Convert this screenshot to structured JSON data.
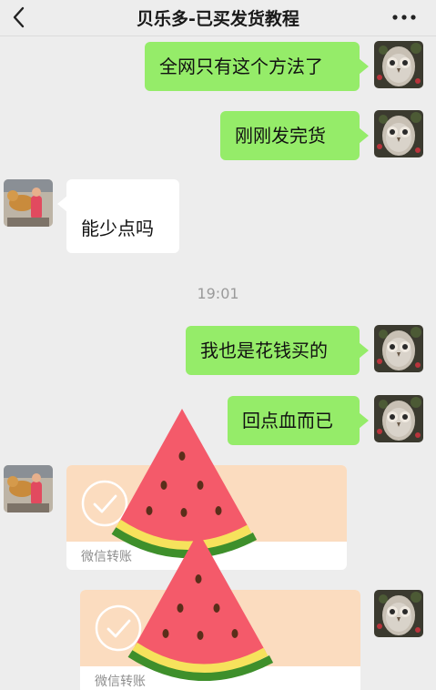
{
  "header": {
    "title": "贝乐多-已买发货教程",
    "back_icon": "back-arrow-icon",
    "more_icon": "more-dots-icon"
  },
  "messages": [
    {
      "side": "me",
      "text": "全网只有这个方法了"
    },
    {
      "side": "me",
      "text": "刚刚发完货"
    },
    {
      "side": "other",
      "text": "能少点吗"
    },
    {
      "side": "me",
      "text": "我也是花钱买的"
    },
    {
      "side": "me",
      "text": "回点血而已"
    }
  ],
  "timestamp": "19:01",
  "transfers": [
    {
      "side": "other",
      "label": "微信转账"
    },
    {
      "side": "me",
      "label": "微信转账"
    }
  ],
  "colors": {
    "me_bubble": "#95ec69",
    "other_bubble": "#ffffff",
    "transfer_top": "#fbdcbf",
    "background": "#ededed"
  },
  "stickers": [
    "watermelon-sticker",
    "watermelon-sticker"
  ]
}
